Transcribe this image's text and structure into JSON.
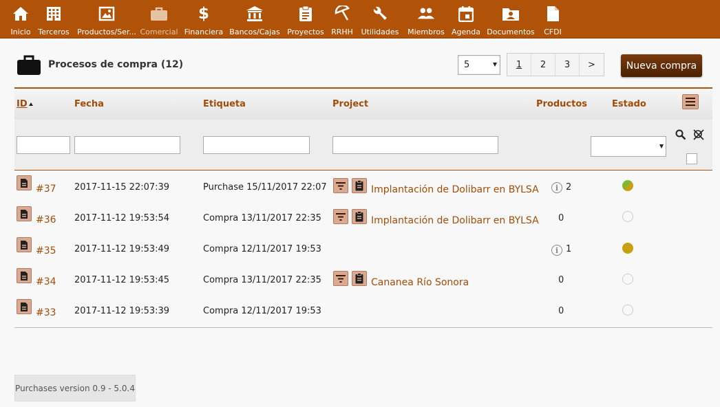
{
  "menu": [
    {
      "label": "Inicio",
      "icon": "home-icon"
    },
    {
      "label": "Terceros",
      "icon": "building-icon"
    },
    {
      "label": "Productos/Ser...",
      "icon": "image-icon"
    },
    {
      "label": "Comercial",
      "icon": "briefcase-icon"
    },
    {
      "label": "Financiera",
      "icon": "dollar-icon"
    },
    {
      "label": "Bancos/Cajas",
      "icon": "bank-icon"
    },
    {
      "label": "Proyectos",
      "icon": "clipboard-icon"
    },
    {
      "label": "RRHH",
      "icon": "umbrella-icon"
    },
    {
      "label": "Utilidades",
      "icon": "wrench-icon"
    },
    {
      "label": "Miembros",
      "icon": "group-icon"
    },
    {
      "label": "Agenda",
      "icon": "calendar-icon"
    },
    {
      "label": "Documentos",
      "icon": "folder-user-icon"
    },
    {
      "label": "CFDI",
      "icon": "file-icon"
    }
  ],
  "page": {
    "title": "Procesos de compra (12)",
    "limit_value": "5",
    "pages": [
      "1",
      "2",
      "3",
      ">"
    ],
    "new_button": "Nueva compra"
  },
  "table": {
    "headers": {
      "id": "ID",
      "fecha": "Fecha",
      "etiqueta": "Etiqueta",
      "project": "Project",
      "productos": "Productos",
      "estado": "Estado"
    },
    "rows": [
      {
        "ref": "#37",
        "fecha": "2017-11-15 22:07:39",
        "etiqueta": "Purchase 15/11/2017 22:07",
        "project": "Implantación de Dolibarr en BYLSA",
        "has_info": true,
        "productos": "2",
        "status": "partial"
      },
      {
        "ref": "#36",
        "fecha": "2017-11-12 19:53:54",
        "etiqueta": "Compra 13/11/2017 22:35",
        "project": "Implantación de Dolibarr en BYLSA",
        "has_info": false,
        "productos": "0",
        "status": "empty"
      },
      {
        "ref": "#35",
        "fecha": "2017-11-12 19:53:49",
        "etiqueta": "Compra 12/11/2017 19:53",
        "project": "",
        "has_info": true,
        "productos": "1",
        "status": "active"
      },
      {
        "ref": "#34",
        "fecha": "2017-11-12 19:53:45",
        "etiqueta": "Compra 13/11/2017 22:35",
        "project": "Cananea Río Sonora",
        "has_info": false,
        "productos": "0",
        "status": "empty"
      },
      {
        "ref": "#33",
        "fecha": "2017-11-12 19:53:39",
        "etiqueta": "Compra 12/11/2017 19:53",
        "project": "",
        "has_info": false,
        "productos": "0",
        "status": "empty"
      }
    ]
  },
  "colors": {
    "brand": "#b05208",
    "link": "#a24c08",
    "status_active": "#c9a012",
    "status_partial_a": "#7cb832",
    "status_partial_b": "#c9a012"
  },
  "footer": {
    "version": "Purchases version 0.9 - 5.0.4"
  }
}
